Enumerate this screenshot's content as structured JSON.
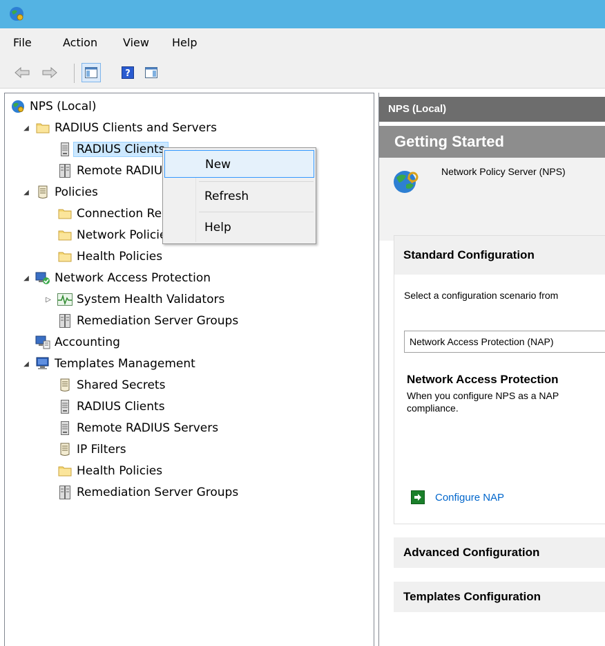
{
  "window": {
    "app_icon": "nps-globe-icon"
  },
  "menu": {
    "items": [
      "File",
      "Action",
      "View",
      "Help"
    ]
  },
  "toolbar": {
    "buttons": [
      "back-arrow-icon",
      "forward-arrow-icon",
      "show-hide-console-tree-icon",
      "help-icon",
      "show-hide-action-pane-icon"
    ]
  },
  "tree": {
    "nodes": [
      {
        "label": "NPS (Local)",
        "icon": "nps-globe-icon",
        "level": 0,
        "expander": ""
      },
      {
        "label": "RADIUS Clients and Servers",
        "icon": "folder-icon",
        "level": 1,
        "expander": "expanded"
      },
      {
        "label": "RADIUS Clients",
        "icon": "server-icon",
        "level": 2,
        "expander": "",
        "selected": true
      },
      {
        "label": "Remote RADIUS Server Groups",
        "icon": "server-group-icon",
        "level": 2,
        "expander": ""
      },
      {
        "label": "Policies",
        "icon": "policy-document-icon",
        "level": 1,
        "expander": "expanded"
      },
      {
        "label": "Connection Request Policies",
        "icon": "folder-icon",
        "level": 2,
        "expander": ""
      },
      {
        "label": "Network Policies",
        "icon": "folder-icon",
        "level": 2,
        "expander": ""
      },
      {
        "label": "Health Policies",
        "icon": "folder-icon",
        "level": 2,
        "expander": ""
      },
      {
        "label": "Network Access Protection",
        "icon": "nap-computer-icon",
        "level": 1,
        "expander": "expanded"
      },
      {
        "label": "System Health Validators",
        "icon": "health-validator-icon",
        "level": 2,
        "expander": "collapsed"
      },
      {
        "label": "Remediation Server Groups",
        "icon": "server-group-icon",
        "level": 2,
        "expander": ""
      },
      {
        "label": "Accounting",
        "icon": "accounting-icon",
        "level": 1,
        "expander": ""
      },
      {
        "label": "Templates Management",
        "icon": "templates-computer-icon",
        "level": 1,
        "expander": "expanded"
      },
      {
        "label": "Shared Secrets",
        "icon": "policy-document-icon",
        "level": 2,
        "expander": ""
      },
      {
        "label": "RADIUS Clients",
        "icon": "server-icon",
        "level": 2,
        "expander": ""
      },
      {
        "label": "Remote RADIUS Servers",
        "icon": "server-icon",
        "level": 2,
        "expander": ""
      },
      {
        "label": "IP Filters",
        "icon": "policy-document-icon",
        "level": 2,
        "expander": ""
      },
      {
        "label": "Health Policies",
        "icon": "folder-icon",
        "level": 2,
        "expander": ""
      },
      {
        "label": "Remediation Server Groups",
        "icon": "server-group-icon",
        "level": 2,
        "expander": ""
      }
    ]
  },
  "context_menu": {
    "items": [
      {
        "label": "New",
        "highlighted": true
      },
      {
        "label": "Refresh"
      },
      {
        "label": "Help"
      }
    ]
  },
  "right_pane": {
    "header": "NPS (Local)",
    "getting_started": "Getting Started",
    "intro_text": "Network Policy Server (NPS)",
    "standard": {
      "title": "Standard Configuration",
      "description": "Select a configuration scenario from",
      "selected_scenario": "Network Access Protection (NAP)",
      "scenario_title": "Network Access Protection",
      "scenario_desc_line1": "When you configure NPS as a NAP",
      "scenario_desc_line2": "compliance.",
      "link": "Configure NAP"
    },
    "advanced": "Advanced Configuration",
    "templates": "Templates Configuration"
  }
}
